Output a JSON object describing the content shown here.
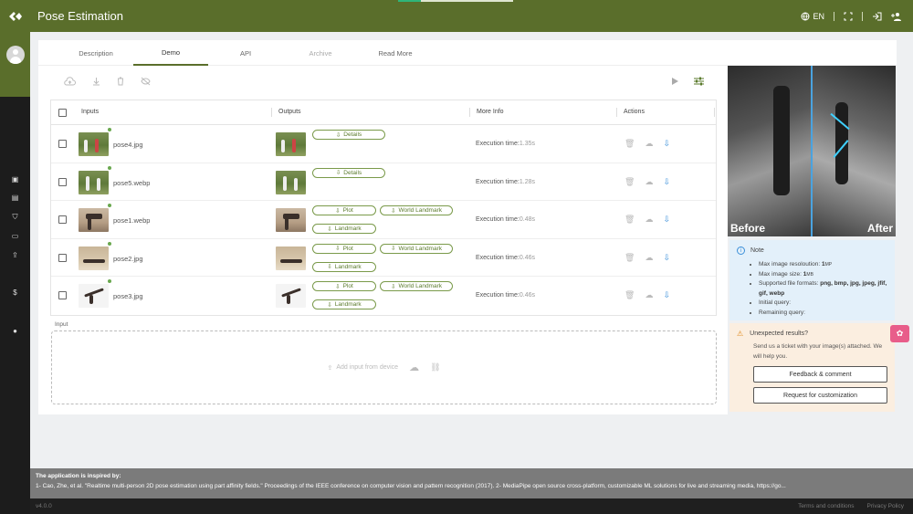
{
  "app": {
    "title": "Pose Estimation",
    "language": "EN",
    "progress": 0.2
  },
  "tabs": [
    {
      "label": "Description"
    },
    {
      "label": "Demo"
    },
    {
      "label": "API"
    },
    {
      "label": "Archive"
    },
    {
      "label": "Read More"
    }
  ],
  "toolbar_icons": [
    "upload-cloud-icon",
    "download-icon",
    "trash-icon",
    "hide-icon"
  ],
  "toolbar_right_icons": [
    "play-icon",
    "sliders-icon"
  ],
  "table": {
    "headers": {
      "inputs": "Inputs",
      "outputs": "Outputs",
      "more_info": "More Info",
      "actions": "Actions"
    },
    "rows": [
      {
        "file": "pose4.jpg",
        "buttons": [
          "Details"
        ],
        "exec_label": "Execution time:",
        "exec_value": "1.35s",
        "thumb": "field"
      },
      {
        "file": "pose5.webp",
        "buttons": [
          "Details"
        ],
        "exec_label": "Execution time:",
        "exec_value": "1.28s",
        "thumb": "field"
      },
      {
        "file": "pose1.webp",
        "buttons": [
          "Plot",
          "World Landmark",
          "Landmark"
        ],
        "exec_label": "Execution time:",
        "exec_value": "0.48s",
        "thumb": "yoga"
      },
      {
        "file": "pose2.jpg",
        "buttons": [
          "Plot",
          "World Landmark",
          "Landmark"
        ],
        "exec_label": "Execution time:",
        "exec_value": "0.46s",
        "thumb": "beach"
      },
      {
        "file": "pose3.jpg",
        "buttons": [
          "Plot",
          "World Landmark",
          "Landmark"
        ],
        "exec_label": "Execution time:",
        "exec_value": "0.46s",
        "thumb": "white"
      }
    ]
  },
  "input": {
    "label": "Input",
    "add_text": "Add input from device"
  },
  "preview": {
    "before": "Before",
    "after": "After"
  },
  "note": {
    "title": "Note",
    "max_res_label": "Max image resoloution:",
    "max_res_value": "1",
    "max_res_unit": "MP",
    "max_size_label": "Max image size:",
    "max_size_value": "1",
    "max_size_unit": "MB",
    "formats_label": "Supported file formats:",
    "formats_value": "png, bmp, jpg, jpeg, jfif, gif, webp",
    "initial_query": "Initial query:",
    "remaining_query": "Remaining query:"
  },
  "unexpected": {
    "title": "Unexpected results?",
    "desc": "Send us a ticket with your image(s) attached. We will help you.",
    "feedback_btn": "Feedback & comment",
    "custom_btn": "Request for customization"
  },
  "footer": {
    "heading": "The application is inspired by:",
    "text": "1- Cao, Zhe, et al. \"Realtime multi-person 2D pose estimation using part affinity fields.\" Proceedings of the IEEE conference on computer vision and pattern recognition (2017). 2- MediaPipe open source cross-platform, customizable ML solutions for live and streaming media, https://go...",
    "version": "v4.0.0",
    "terms": "Terms and conditions",
    "privacy": "Privacy Policy"
  }
}
